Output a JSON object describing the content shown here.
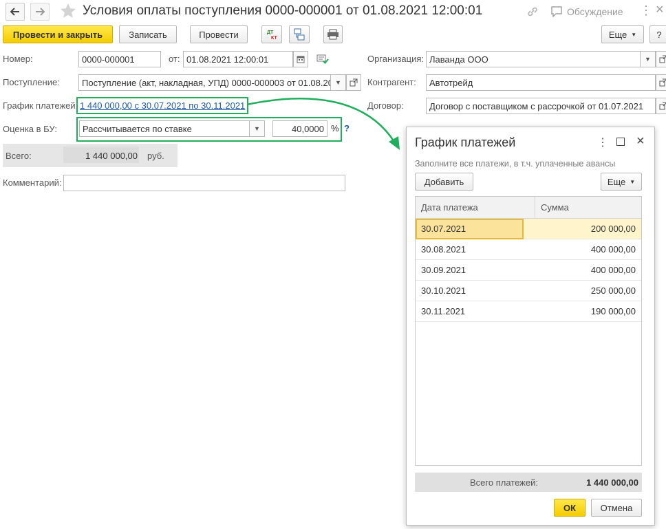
{
  "window": {
    "title": "Условия оплаты поступления 0000-000001 от 01.08.2021 12:00:01",
    "discussion": "Обсуждение",
    "colors": {
      "accent_yellow": "#f4cc00",
      "highlight_green": "#1fae5b",
      "link": "#1a5aa8"
    }
  },
  "toolbar": {
    "post_close": "Провести и закрыть",
    "save": "Записать",
    "post": "Провести",
    "more": "Еще",
    "help": "?"
  },
  "form": {
    "number_label": "Номер:",
    "number_value": "0000-000001",
    "from_label": "от:",
    "date_value": "01.08.2021 12:00:01",
    "receipt_label": "Поступление:",
    "receipt_value": "Поступление (акт, накладная, УПД) 0000-000003 от 01.08.20",
    "schedule_label": "График платежей:",
    "schedule_link": "1 440 000,00 с 30.07.2021 по 30.11.2021",
    "estimate_label": "Оценка в БУ:",
    "estimate_value": "Рассчитывается по ставке",
    "rate_value": "40,0000",
    "rate_unit": "%",
    "rate_help": "?",
    "total_label": "Всего:",
    "total_value": "1 440 000,00",
    "total_currency": "руб.",
    "comment_label": "Комментарий:",
    "comment_value": "",
    "org_label": "Организация:",
    "org_value": "Лаванда ООО",
    "counterparty_label": "Контрагент:",
    "counterparty_value": "Автотрейд",
    "contract_label": "Договор:",
    "contract_value": "Договор с поставщиком с рассрочкой от 01.07.2021"
  },
  "dialog": {
    "title": "График платежей",
    "hint": "Заполните все платежи, в т.ч. уплаченные авансы",
    "add": "Добавить",
    "more": "Еще",
    "col_date": "Дата платежа",
    "col_sum": "Сумма",
    "rows": [
      {
        "date": "30.07.2021",
        "sum": "200 000,00"
      },
      {
        "date": "30.08.2021",
        "sum": "400 000,00"
      },
      {
        "date": "30.09.2021",
        "sum": "400 000,00"
      },
      {
        "date": "30.10.2021",
        "sum": "250 000,00"
      },
      {
        "date": "30.11.2021",
        "sum": "190 000,00"
      }
    ],
    "total_label": "Всего платежей:",
    "total_value": "1 440 000,00",
    "ok": "ОК",
    "cancel": "Отмена"
  }
}
